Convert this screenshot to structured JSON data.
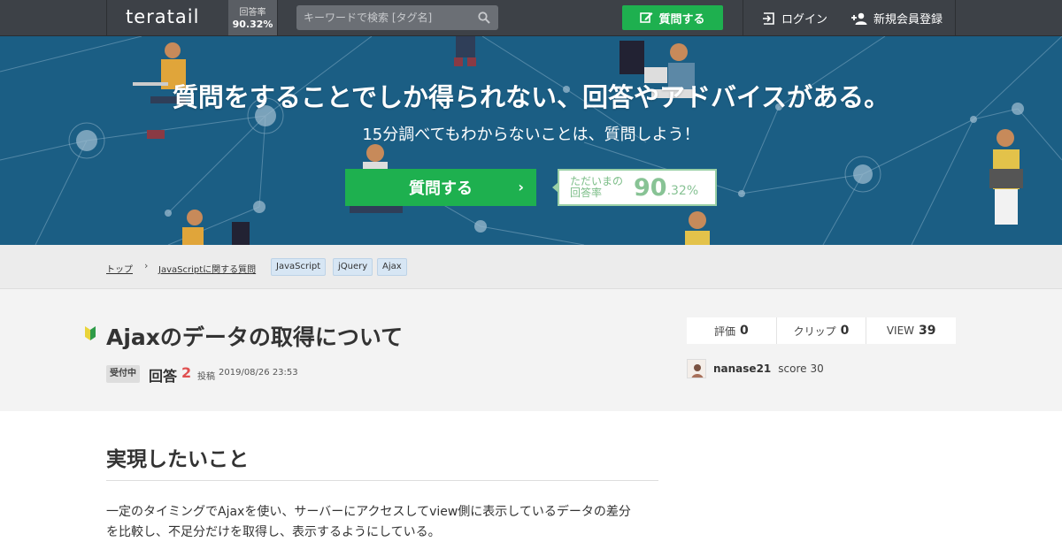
{
  "header": {
    "logo": "teratail",
    "rate_label": "回答率",
    "rate_value": "90.32%",
    "search_placeholder": "キーワードで検索 [タグ名]",
    "ask_label": "質問する",
    "login_label": "ログイン",
    "signup_label": "新規会員登録"
  },
  "hero": {
    "title": "質問をすることでしか得られない、回答やアドバイスがある。",
    "subtitle": "15分調べてもわからないことは、質問しよう！",
    "ask_button": "質問する",
    "rate_label_line1": "ただいまの",
    "rate_label_line2": "回答率",
    "rate_big": "90",
    "rate_small": ".32%"
  },
  "breadcrumb": {
    "top": "トップ",
    "separator": "›",
    "category": "JavaScriptに関する質問",
    "tags": [
      "JavaScript",
      "jQuery",
      "Ajax"
    ]
  },
  "question": {
    "title": "Ajaxのデータの取得について",
    "status": "受付中",
    "answers_label": "回答",
    "answers_count": "2",
    "posted_label": "投稿",
    "posted_date": "2019/08/26 23:53",
    "stats": [
      {
        "label": "評価",
        "value": "0"
      },
      {
        "label": "クリップ",
        "value": "0"
      },
      {
        "label": "VIEW",
        "value": "39"
      }
    ],
    "user": {
      "name": "nanase21",
      "score_label": "score",
      "score": "30"
    }
  },
  "content": {
    "section_title": "実現したいこと",
    "line1": "一定のタイミングでAjaxを使い、サーバーにアクセスしてview側に表示しているデータの差分",
    "line2": "を比較し、不足分だけを取得し、表示するようにしている。"
  },
  "colors": {
    "header_bg": "#3d4147",
    "hero_bg": "#1b5e84",
    "accent_green": "#1eb04f",
    "answer_count": "#e05050"
  }
}
